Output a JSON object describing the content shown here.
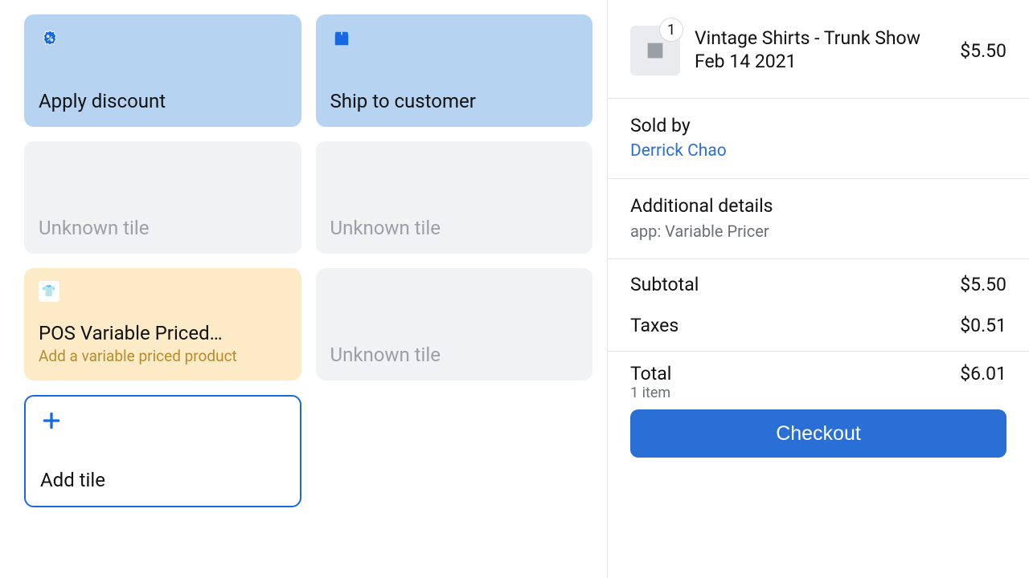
{
  "tiles": {
    "apply_discount": "Apply discount",
    "ship_to_customer": "Ship to customer",
    "unknown": "Unknown tile",
    "variable_priced_title": "POS Variable Priced…",
    "variable_priced_sub": "Add a variable priced product",
    "add_tile": "Add tile"
  },
  "cart": {
    "item_qty": "1",
    "item_name": "Vintage Shirts - Trunk Show Feb 14 2021",
    "item_price": "$5.50",
    "sold_by_label": "Sold by",
    "sold_by_name": "Derrick Chao",
    "additional_details_label": "Additional details",
    "additional_details_value": "app: Variable Pricer",
    "subtotal_label": "Subtotal",
    "subtotal_value": "$5.50",
    "taxes_label": "Taxes",
    "taxes_value": "$0.51",
    "total_label": "Total",
    "total_items": "1 item",
    "total_value": "$6.01",
    "checkout_label": "Checkout"
  }
}
